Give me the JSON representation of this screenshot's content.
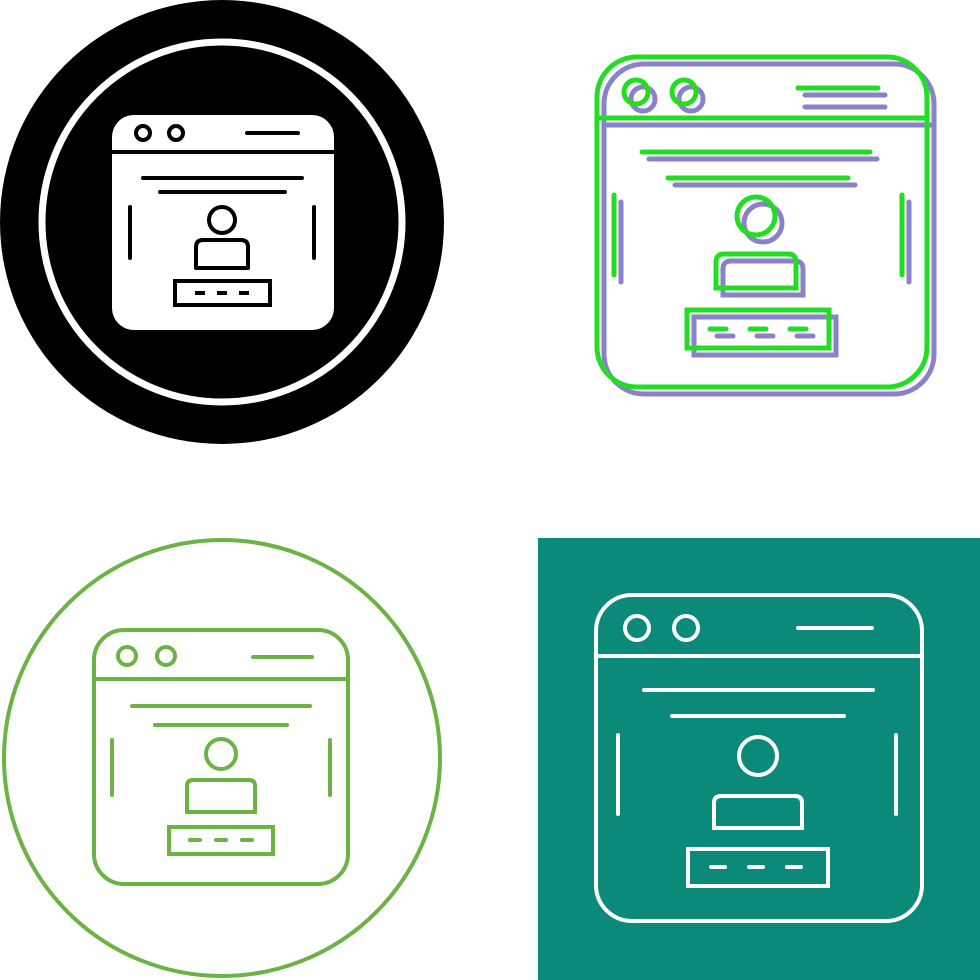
{
  "icon_set": {
    "subject": "browser-window-user-login-icon",
    "variants": [
      {
        "style": "glyph-in-circle",
        "colors": {
          "fill": "#000000",
          "detail": "#ffffff"
        }
      },
      {
        "style": "two-tone-offset-outline",
        "colors": {
          "stroke": "#22dd22",
          "shadow": "#8a82c8"
        }
      },
      {
        "style": "outline-in-circle",
        "colors": {
          "stroke": "#6ab344"
        }
      },
      {
        "style": "outline-on-square",
        "colors": {
          "background": "#0b8a7a",
          "stroke": "#ffffff"
        }
      }
    ]
  }
}
